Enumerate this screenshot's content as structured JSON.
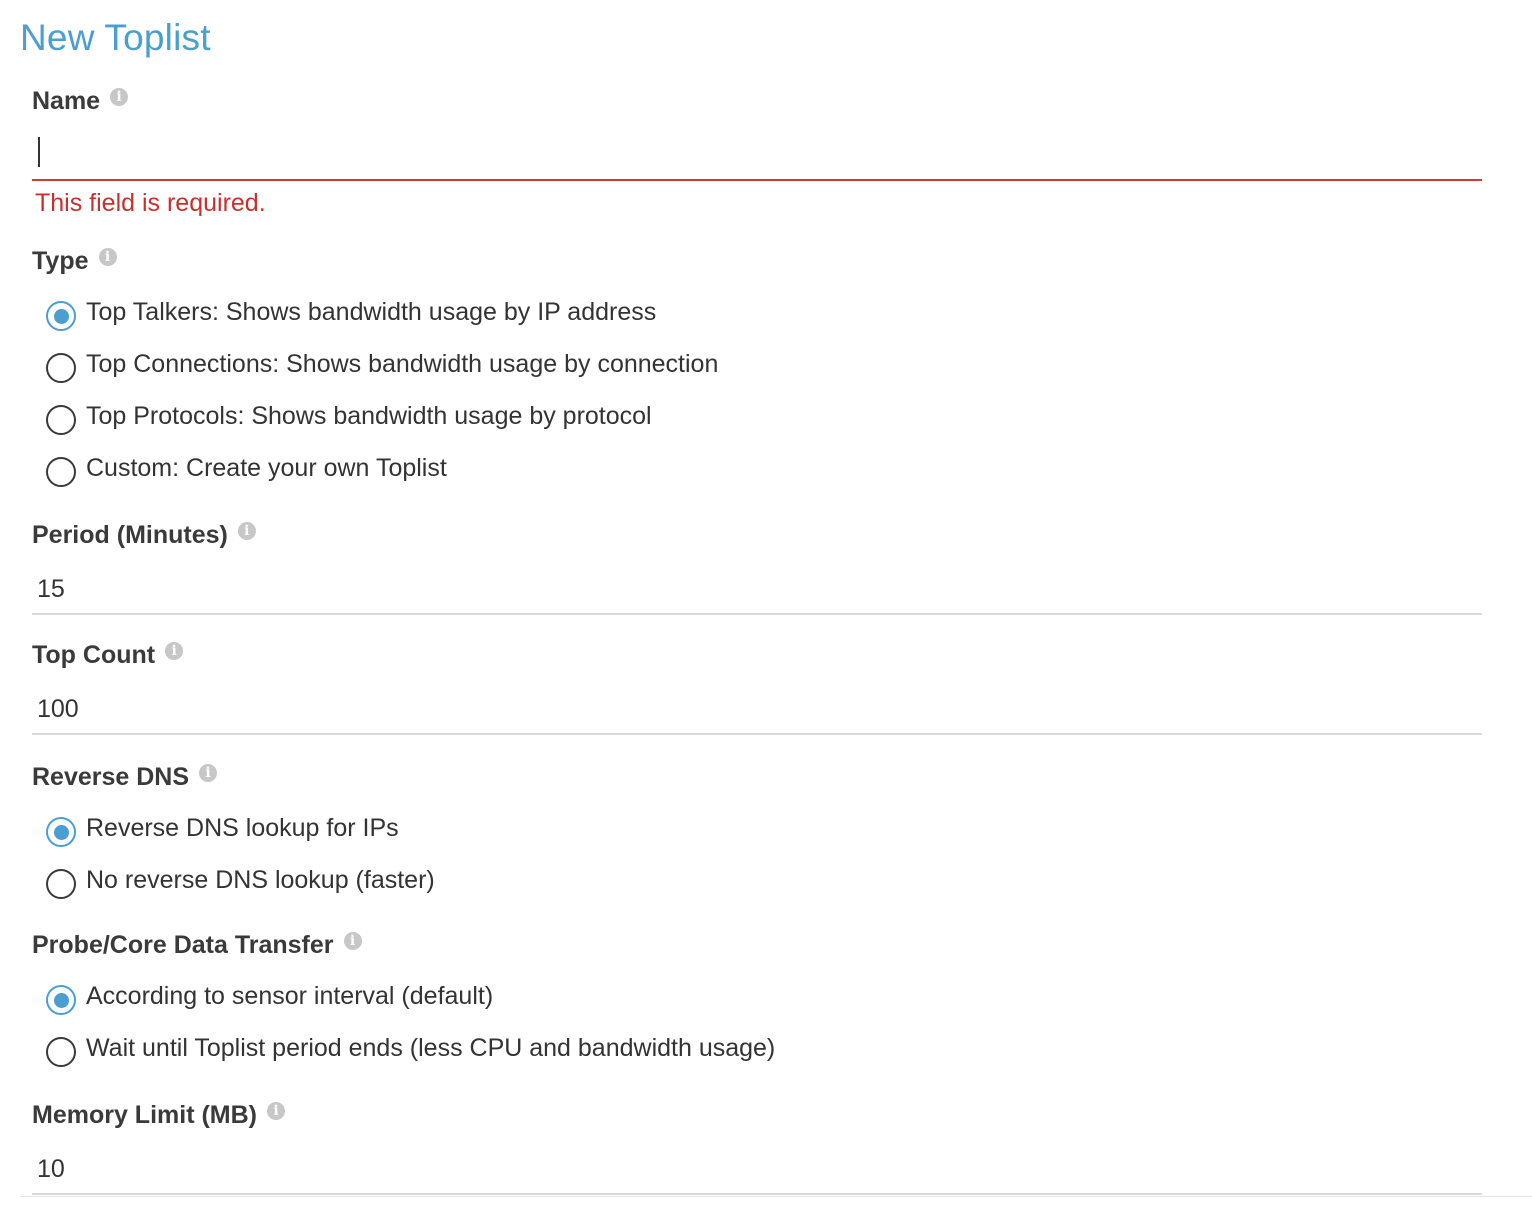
{
  "page": {
    "title": "New Toplist"
  },
  "name_field": {
    "label": "Name",
    "value": "",
    "error": "This field is required."
  },
  "type_field": {
    "label": "Type",
    "options": [
      {
        "label": "Top Talkers: Shows bandwidth usage by IP address",
        "checked": true
      },
      {
        "label": "Top Connections: Shows bandwidth usage by connection",
        "checked": false
      },
      {
        "label": "Top Protocols: Shows bandwidth usage by protocol",
        "checked": false
      },
      {
        "label": "Custom: Create your own Toplist",
        "checked": false
      }
    ]
  },
  "period_field": {
    "label": "Period (Minutes)",
    "value": "15"
  },
  "top_count_field": {
    "label": "Top Count",
    "value": "100"
  },
  "reverse_dns_field": {
    "label": "Reverse DNS",
    "options": [
      {
        "label": "Reverse DNS lookup for IPs",
        "checked": true
      },
      {
        "label": "No reverse DNS lookup (faster)",
        "checked": false
      }
    ]
  },
  "data_transfer_field": {
    "label": "Probe/Core Data Transfer",
    "options": [
      {
        "label": "According to sensor interval (default)",
        "checked": true
      },
      {
        "label": "Wait until Toplist period ends (less CPU and bandwidth usage)",
        "checked": false
      }
    ]
  },
  "memory_limit_field": {
    "label": "Memory Limit (MB)",
    "value": "10"
  },
  "icons": {
    "info": "info-icon",
    "info_glyph": "i"
  },
  "colors": {
    "accent": "#4a9fd0",
    "error": "#c9302c",
    "label": "#3a3a3a",
    "text": "#333333",
    "input_border": "#d9d9d9",
    "info_icon": "#c7c7c7"
  }
}
